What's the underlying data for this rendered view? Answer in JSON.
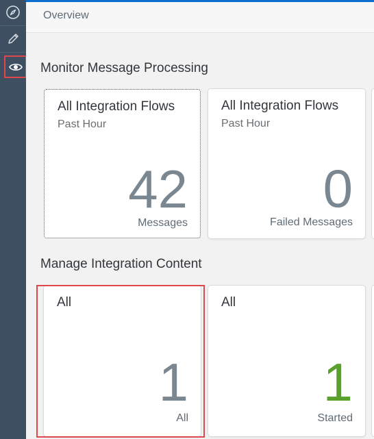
{
  "header": {
    "title": "Overview"
  },
  "nav": {
    "items": [
      {
        "name": "discover-icon"
      },
      {
        "name": "design-icon"
      },
      {
        "name": "monitor-icon",
        "selected": true
      }
    ]
  },
  "sections": {
    "monitor": {
      "title": "Monitor Message Processing",
      "tiles": [
        {
          "title": "All Integration Flows",
          "subtitle": "Past Hour",
          "number": "42",
          "unit": "Messages"
        },
        {
          "title": "All Integration Flows",
          "subtitle": "Past Hour",
          "number": "0",
          "unit": "Failed Messages"
        }
      ]
    },
    "content": {
      "title": "Manage Integration Content",
      "tiles": [
        {
          "title": "All",
          "number": "1",
          "unit": "All",
          "number_color": "#7a8791"
        },
        {
          "title": "All",
          "number": "1",
          "unit": "Started",
          "number_color": "#5aa02c"
        }
      ]
    }
  },
  "colors": {
    "accent": "#0a6ed1",
    "highlight": "#e0474c",
    "rail": "#3d4f61",
    "started": "#5aa02c"
  }
}
